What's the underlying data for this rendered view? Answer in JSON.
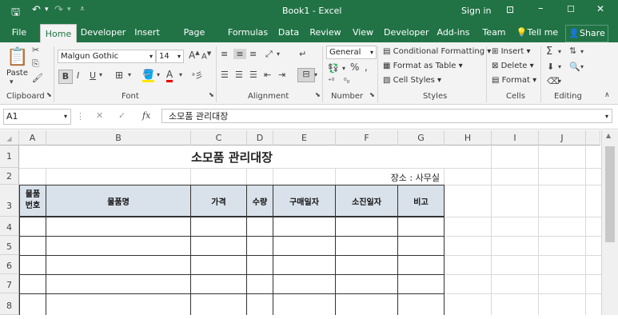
{
  "titlebar": {
    "title": "Book1 - Excel",
    "signin": "Sign in",
    "undo_icon": "undo-icon",
    "redo_icon": "redo-icon"
  },
  "tabs": [
    "File",
    "Home",
    "Developer",
    "Insert",
    "Page Layout",
    "Formulas",
    "Data",
    "Review",
    "View",
    "Developer",
    "Add-ins",
    "Team"
  ],
  "tellme": "Tell me",
  "share": "Share",
  "ribbon": {
    "clipboard": {
      "paste": "Paste",
      "label": "Clipboard"
    },
    "font": {
      "name": "Malgun Gothic",
      "size": "14",
      "bold": "B",
      "italic": "I",
      "underline": "U",
      "label": "Font"
    },
    "alignment": {
      "label": "Alignment"
    },
    "number": {
      "format": "General",
      "label": "Number"
    },
    "styles": {
      "cond": "Conditional Formatting",
      "table": "Format as Table",
      "cell": "Cell Styles",
      "label": "Styles"
    },
    "cells": {
      "insert": "Insert",
      "delete": "Delete",
      "format": "Format",
      "label": "Cells"
    },
    "editing": {
      "label": "Editing"
    }
  },
  "formula_bar": {
    "name_box": "A1",
    "fx": "fx",
    "content": "소모품 관리대장"
  },
  "columns": [
    "A",
    "B",
    "C",
    "D",
    "E",
    "F",
    "G",
    "H",
    "I",
    "J"
  ],
  "rows": [
    "1",
    "2",
    "3",
    "4",
    "5",
    "6",
    "7",
    "8"
  ],
  "sheet": {
    "title": "소모품 관리대장",
    "location": "장소 : 사무실",
    "headers": [
      "물품\n번호",
      "물품명",
      "가격",
      "수량",
      "구매일자",
      "소진일자",
      "비고"
    ]
  },
  "colors": {
    "accent": "#217346",
    "header_fill": "#d9e1ea"
  }
}
